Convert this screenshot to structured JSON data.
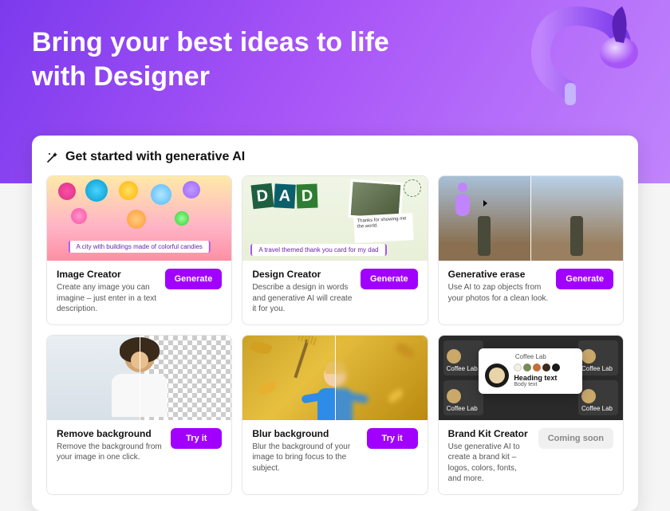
{
  "hero": {
    "title": "Bring your best ideas to life with Designer"
  },
  "section": {
    "heading": "Get started with generative AI"
  },
  "cards": [
    {
      "title": "Image Creator",
      "desc": "Create any image you can imagine – just enter in a text description.",
      "cta": "Generate",
      "prompt": "A city with buildings made of colorful candies"
    },
    {
      "title": "Design Creator",
      "desc": "Describe a design in words and generative AI will create it for you.",
      "cta": "Generate",
      "collage_letters": "DAD",
      "note_text": "Thanks for showing me the world.",
      "prompt": "A travel themed thank you card for my dad"
    },
    {
      "title": "Generative erase",
      "desc": "Use AI to zap objects from your photos for a clean look.",
      "cta": "Generate"
    },
    {
      "title": "Remove background",
      "desc": "Remove the background from your image in one click.",
      "cta": "Try it"
    },
    {
      "title": "Blur background",
      "desc": "Blur the background of your image to bring focus to the subject.",
      "cta": "Try it"
    },
    {
      "title": "Brand Kit Creator",
      "desc": "Use generative AI to create a brand kit – logos, colors, fonts, and more.",
      "cta": "Coming soon",
      "brand_popup": {
        "name": "Coffee Lab",
        "heading": "Heading text",
        "body": "Body text",
        "swatches": [
          "#f5f0e6",
          "#7a8a5a",
          "#c0703a",
          "#3a2a1a",
          "#1a1a1a"
        ],
        "tile_label": "Coffee Lab"
      }
    }
  ],
  "colors": {
    "accent": "#a100ff"
  }
}
